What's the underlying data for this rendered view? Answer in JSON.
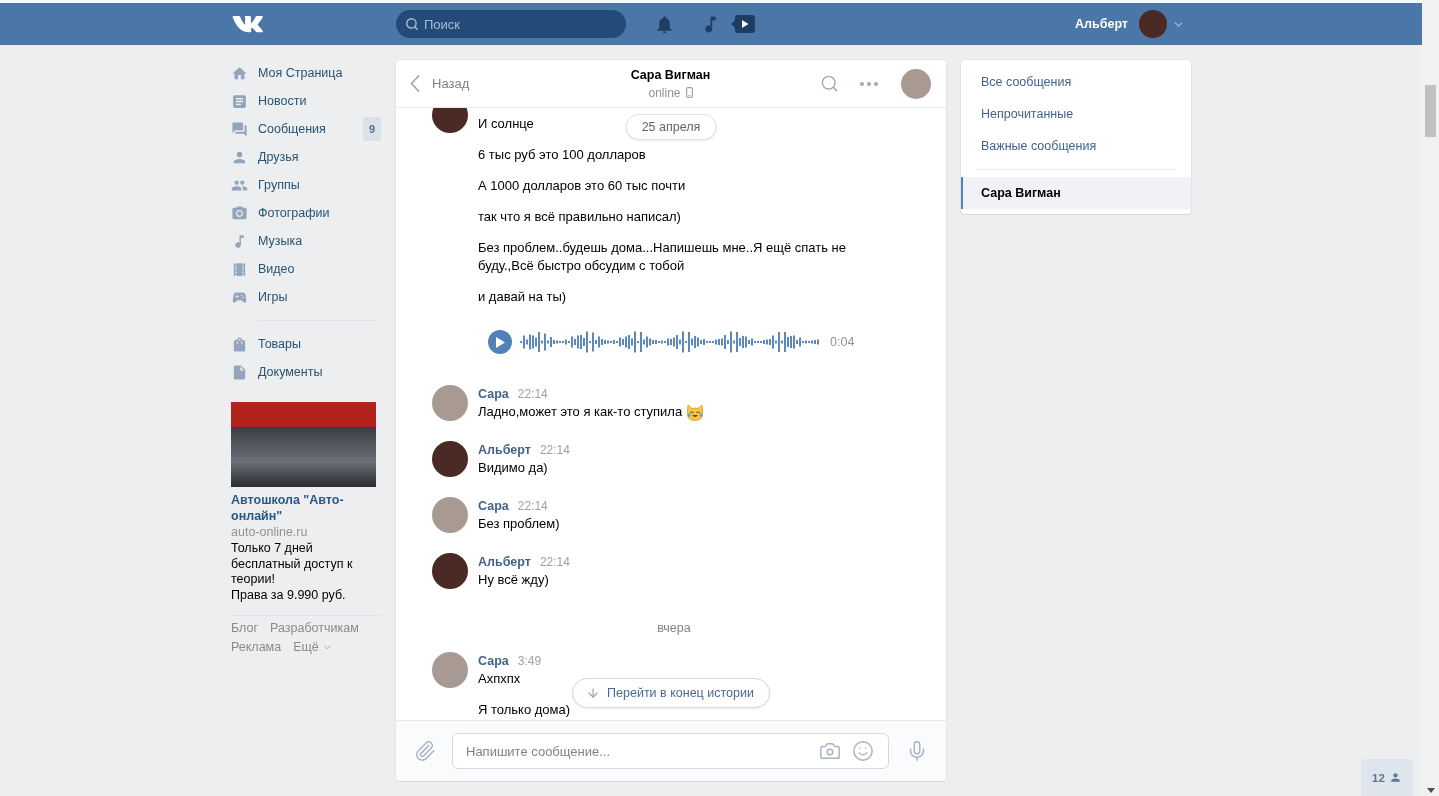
{
  "header": {
    "search": {
      "placeholder": "Поиск"
    },
    "user": {
      "name": "Альберт"
    }
  },
  "sidebar": {
    "menu": [
      {
        "label": "Моя Страница"
      },
      {
        "label": "Новости"
      },
      {
        "label": "Сообщения",
        "badge": "9"
      },
      {
        "label": "Друзья"
      },
      {
        "label": "Группы"
      },
      {
        "label": "Фотографии"
      },
      {
        "label": "Музыка"
      },
      {
        "label": "Видео"
      },
      {
        "label": "Игры"
      }
    ],
    "menu_extra": [
      {
        "label": "Товары"
      },
      {
        "label": "Документы"
      }
    ],
    "ad": {
      "title": "Автошкола \"Авто-онлайн\"",
      "domain": "auto-online.ru",
      "text": "Только 7 дней бесплатный доступ к теории!\nПрава за 9.990 руб."
    },
    "footer_links": [
      {
        "label": "Блог",
        "dropdown": false
      },
      {
        "label": "Разработчикам",
        "dropdown": false
      },
      {
        "label": "Реклама",
        "dropdown": false
      },
      {
        "label": "Ещё",
        "dropdown": true
      }
    ]
  },
  "chat": {
    "back": "Назад",
    "title": "Сара Вигман",
    "status": "online",
    "mobile": true,
    "date_pill": "25 апреля",
    "history": [
      {
        "kind": "messages",
        "outgoing": true,
        "items": [
          {
            "kind": "text",
            "text": "И солнце"
          },
          {
            "kind": "text",
            "text": "6 тыс руб это 100 долларов"
          },
          {
            "kind": "text",
            "text": "А 1000 долларов это 60 тыс почти"
          },
          {
            "kind": "text",
            "text": "так что я всё правильно написал)"
          },
          {
            "kind": "text",
            "text": "Без проблем..будешь дома...Напишешь мне..Я ещё спать не буду.,Всё быстро обсудим с тобой"
          },
          {
            "kind": "text",
            "text": "и давай на ты)"
          },
          {
            "kind": "audio",
            "duration": "0:04"
          }
        ]
      },
      {
        "kind": "messages",
        "author": "Сара",
        "time": "22:14",
        "outgoing": false,
        "items": [
          {
            "kind": "emoji_text",
            "text": "Ладно,может это я как-то ступила"
          }
        ]
      },
      {
        "kind": "messages",
        "author": "Альберт",
        "time": "22:14",
        "outgoing": true,
        "items": [
          {
            "kind": "text",
            "text": "Видимо да)"
          }
        ]
      },
      {
        "kind": "messages",
        "author": "Сара",
        "time": "22:14",
        "outgoing": false,
        "items": [
          {
            "kind": "text",
            "text": "Без проблем)"
          }
        ]
      },
      {
        "kind": "messages",
        "author": "Альберт",
        "time": "22:14",
        "outgoing": true,
        "items": [
          {
            "kind": "text",
            "text": "Ну всё жду)"
          }
        ]
      },
      {
        "kind": "date",
        "text": "вчера"
      },
      {
        "kind": "messages",
        "author": "Сара",
        "time": "3:49",
        "outgoing": false,
        "items": [
          {
            "kind": "text",
            "text": "Ахпхпх"
          },
          {
            "kind": "text",
            "text": "Я только дома)"
          }
        ]
      }
    ],
    "jump_button": "Перейти в конец истории",
    "composer": {
      "placeholder": "Напишите сообщение..."
    }
  },
  "filters": [
    {
      "label": "Все сообщения",
      "selected": false
    },
    {
      "label": "Непрочитанные",
      "selected": false
    },
    {
      "label": "Важные сообщения",
      "selected": false
    }
  ],
  "conversations": [
    {
      "label": "Сара Вигман",
      "selected": true
    }
  ],
  "friends_online": {
    "count": "12"
  }
}
